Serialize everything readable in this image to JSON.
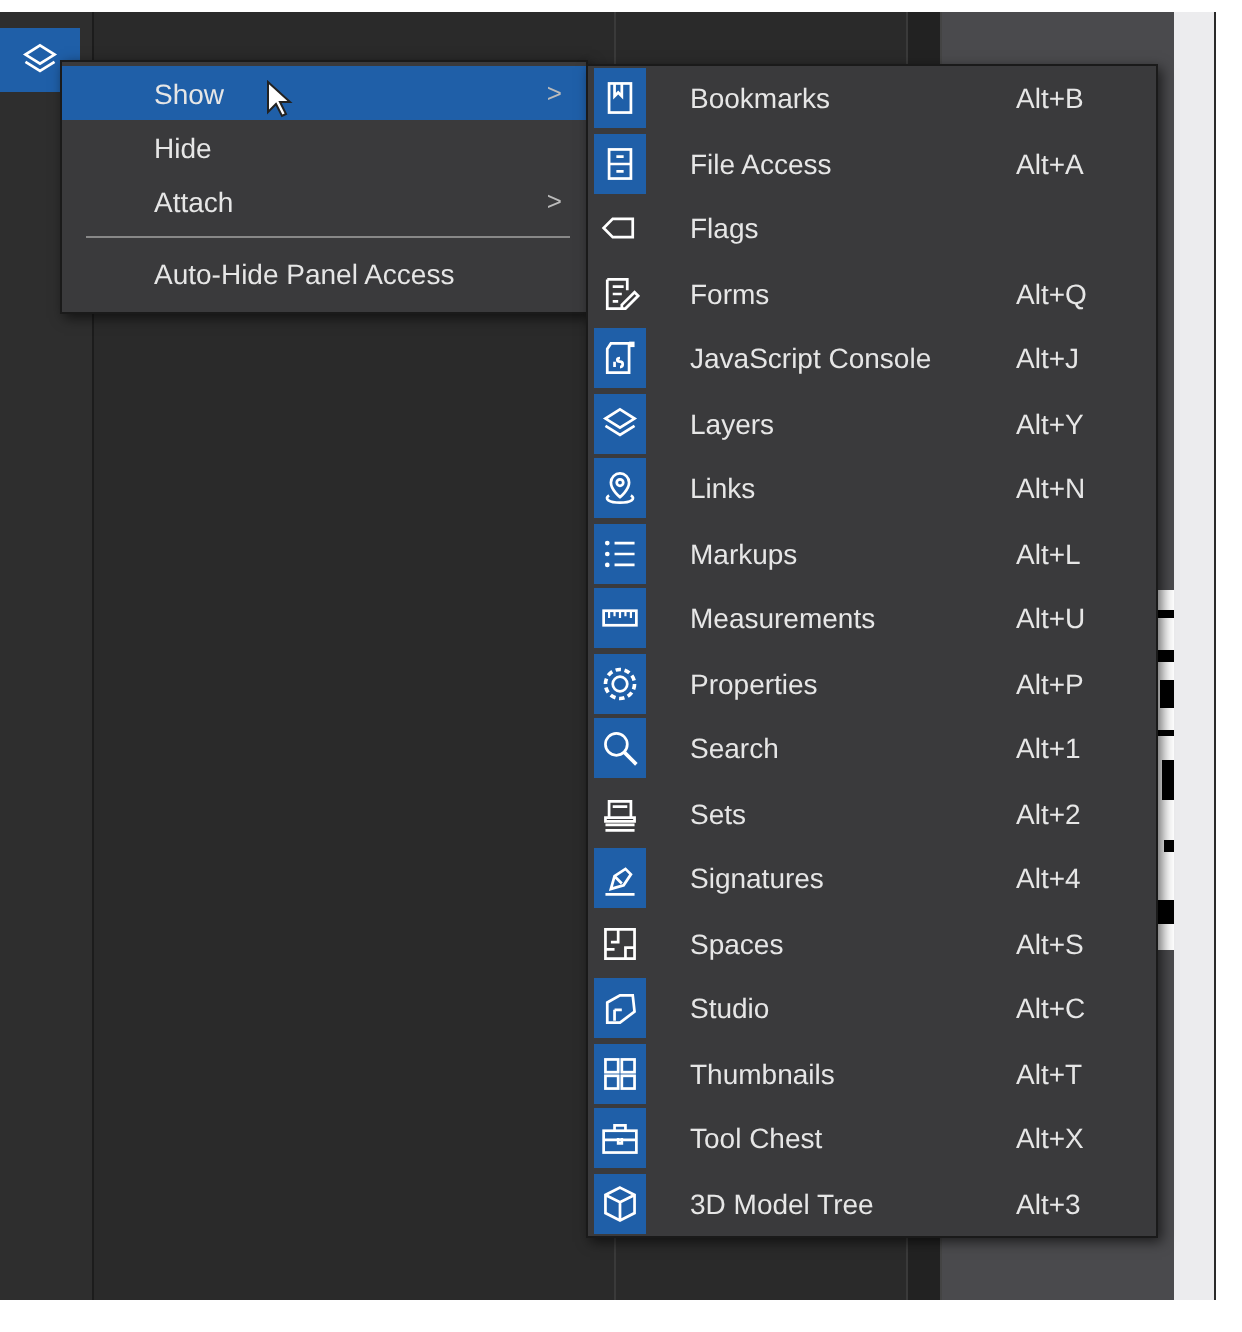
{
  "context_menu": {
    "items": [
      {
        "label": "Show",
        "selected": true,
        "submenu": true
      },
      {
        "label": "Hide",
        "selected": false,
        "submenu": false
      },
      {
        "label": "Attach",
        "selected": false,
        "submenu": true
      },
      {
        "label": "Auto-Hide Panel Access",
        "selected": false,
        "submenu": false,
        "separator_before": true
      }
    ]
  },
  "submenu_arrow": ">",
  "show_submenu": {
    "items": [
      {
        "label": "Bookmarks",
        "shortcut": "Alt+B",
        "shown": true
      },
      {
        "label": "File Access",
        "shortcut": "Alt+A",
        "shown": true
      },
      {
        "label": "Flags",
        "shown": false
      },
      {
        "label": "Forms",
        "shortcut": "Alt+Q",
        "shown": false
      },
      {
        "label": "JavaScript Console",
        "shortcut": "Alt+J",
        "shown": true
      },
      {
        "label": "Layers",
        "shortcut": "Alt+Y",
        "shown": true
      },
      {
        "label": "Links",
        "shortcut": "Alt+N",
        "shown": true
      },
      {
        "label": "Markups",
        "shortcut": "Alt+L",
        "shown": true
      },
      {
        "label": "Measurements",
        "shortcut": "Alt+U",
        "shown": true
      },
      {
        "label": "Properties",
        "shortcut": "Alt+P",
        "shown": true
      },
      {
        "label": "Search",
        "shortcut": "Alt+1",
        "shown": true
      },
      {
        "label": "Sets",
        "shortcut": "Alt+2",
        "shown": false
      },
      {
        "label": "Signatures",
        "shortcut": "Alt+4",
        "shown": true
      },
      {
        "label": "Spaces",
        "shortcut": "Alt+S",
        "shown": false
      },
      {
        "label": "Studio",
        "shortcut": "Alt+C",
        "shown": true
      },
      {
        "label": "Thumbnails",
        "shortcut": "Alt+T",
        "shown": true
      },
      {
        "label": "Tool Chest",
        "shortcut": "Alt+X",
        "shown": true
      },
      {
        "label": "3D Model Tree",
        "shortcut": "Alt+3",
        "shown": true
      }
    ]
  }
}
